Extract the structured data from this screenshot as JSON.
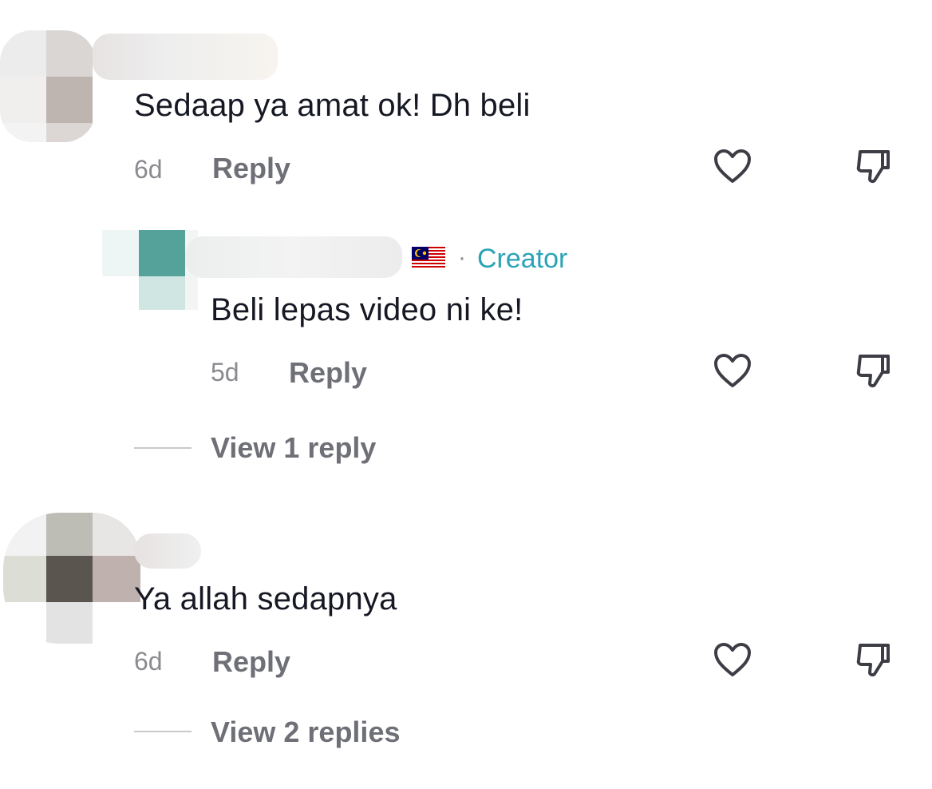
{
  "comments": [
    {
      "text": "Sedaap ya amat ok! Dh beli",
      "time": "6d",
      "reply_label": "Reply"
    },
    {
      "text": "Beli lepas video ni ke!",
      "time": "5d",
      "reply_label": "Reply",
      "badge_separator": "·",
      "badge": "Creator",
      "is_reply": true
    },
    {
      "text": "Ya allah sedapnya",
      "time": "6d",
      "reply_label": "Reply"
    }
  ],
  "thread1": {
    "view_replies_label": "View 1 reply"
  },
  "thread2": {
    "view_replies_label": "View 2 replies"
  },
  "icons": {
    "like": "heart-outline-icon",
    "dislike": "thumbs-down-outline-icon",
    "flag": "malaysia-flag-icon"
  },
  "colors": {
    "text": "#161823",
    "secondary": "#6f7077",
    "timestamp": "#8a8b91",
    "creator": "#2aa3b7"
  }
}
